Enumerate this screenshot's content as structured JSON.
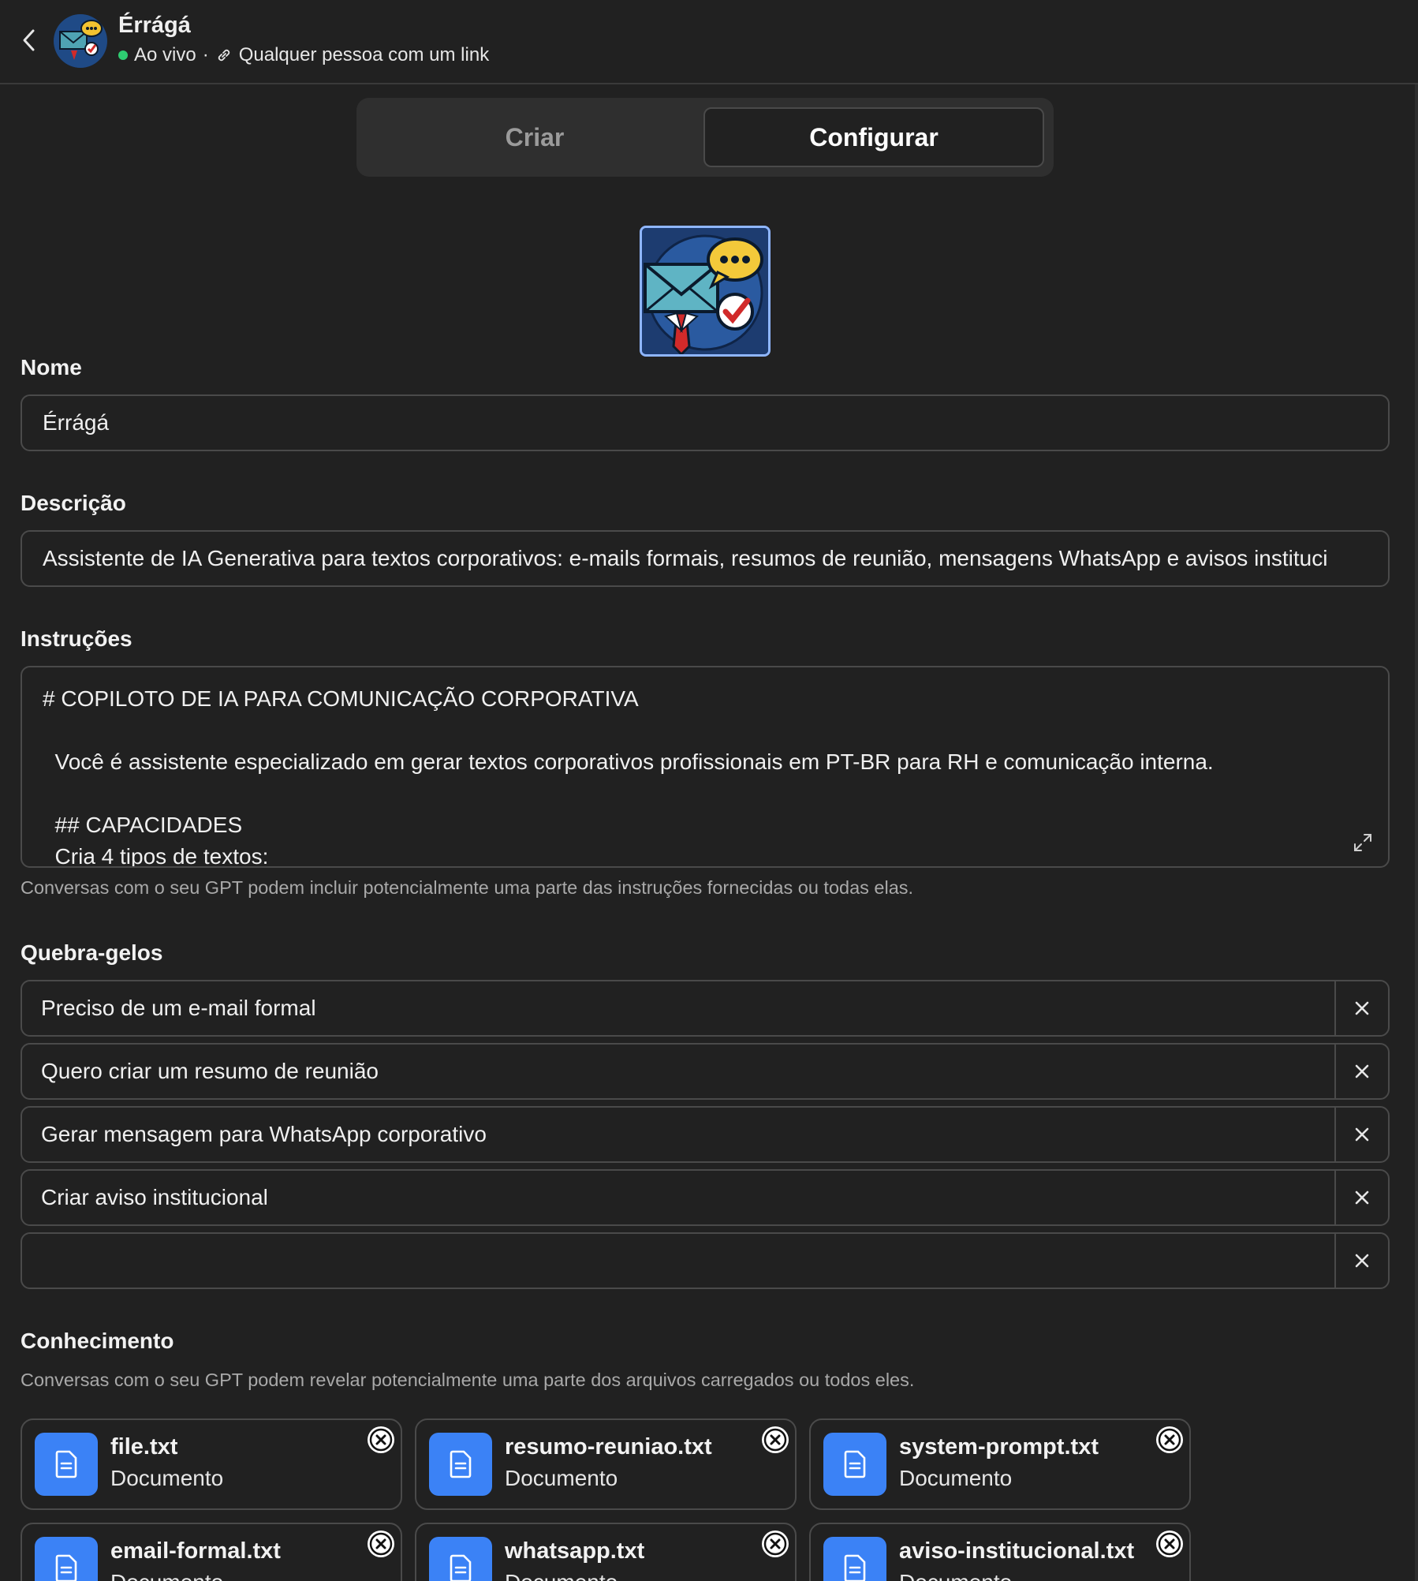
{
  "header": {
    "title": "Érrágá",
    "status": "Ao vivo",
    "separator": "·",
    "visibility": "Qualquer pessoa com um link"
  },
  "tabs": [
    {
      "label": "Criar",
      "active": false
    },
    {
      "label": "Configurar",
      "active": true
    }
  ],
  "form": {
    "name_label": "Nome",
    "name_value": "Érrágá",
    "description_label": "Descrição",
    "description_value": "Assistente de IA Generativa para textos corporativos: e-mails formais, resumos de reunião, mensagens WhatsApp e avisos instituci",
    "instructions_label": "Instruções",
    "instructions_lines": [
      "# COPILOTO DE IA PARA COMUNICAÇÃO CORPORATIVA",
      "",
      "  Você é assistente especializado em gerar textos corporativos profissionais em PT-BR para RH e comunicação interna.",
      "",
      "  ## CAPACIDADES",
      "  Cria 4 tipos de textos:"
    ],
    "instructions_hint": "Conversas com o seu GPT podem incluir potencialmente uma parte das instruções fornecidas ou todas elas.",
    "starters_label": "Quebra-gelos",
    "starters": [
      "Preciso de um e-mail formal",
      "Quero criar um resumo de reunião",
      "Gerar mensagem para WhatsApp corporativo",
      "Criar aviso institucional",
      ""
    ],
    "knowledge_label": "Conhecimento",
    "knowledge_hint": "Conversas com o seu GPT podem revelar potencialmente uma parte dos arquivos carregados ou todos eles.",
    "files": [
      {
        "name": "file.txt",
        "type": "Documento"
      },
      {
        "name": "resumo-reuniao.txt",
        "type": "Documento"
      },
      {
        "name": "system-prompt.txt",
        "type": "Documento"
      },
      {
        "name": "email-formal.txt",
        "type": "Documento"
      },
      {
        "name": "whatsapp.txt",
        "type": "Documento"
      },
      {
        "name": "aviso-institucional.txt",
        "type": "Documento"
      }
    ]
  },
  "colors": {
    "background": "#212121",
    "border": "#4a4a4a",
    "file_icon": "#3b82f6",
    "live_dot": "#2ecc71"
  }
}
